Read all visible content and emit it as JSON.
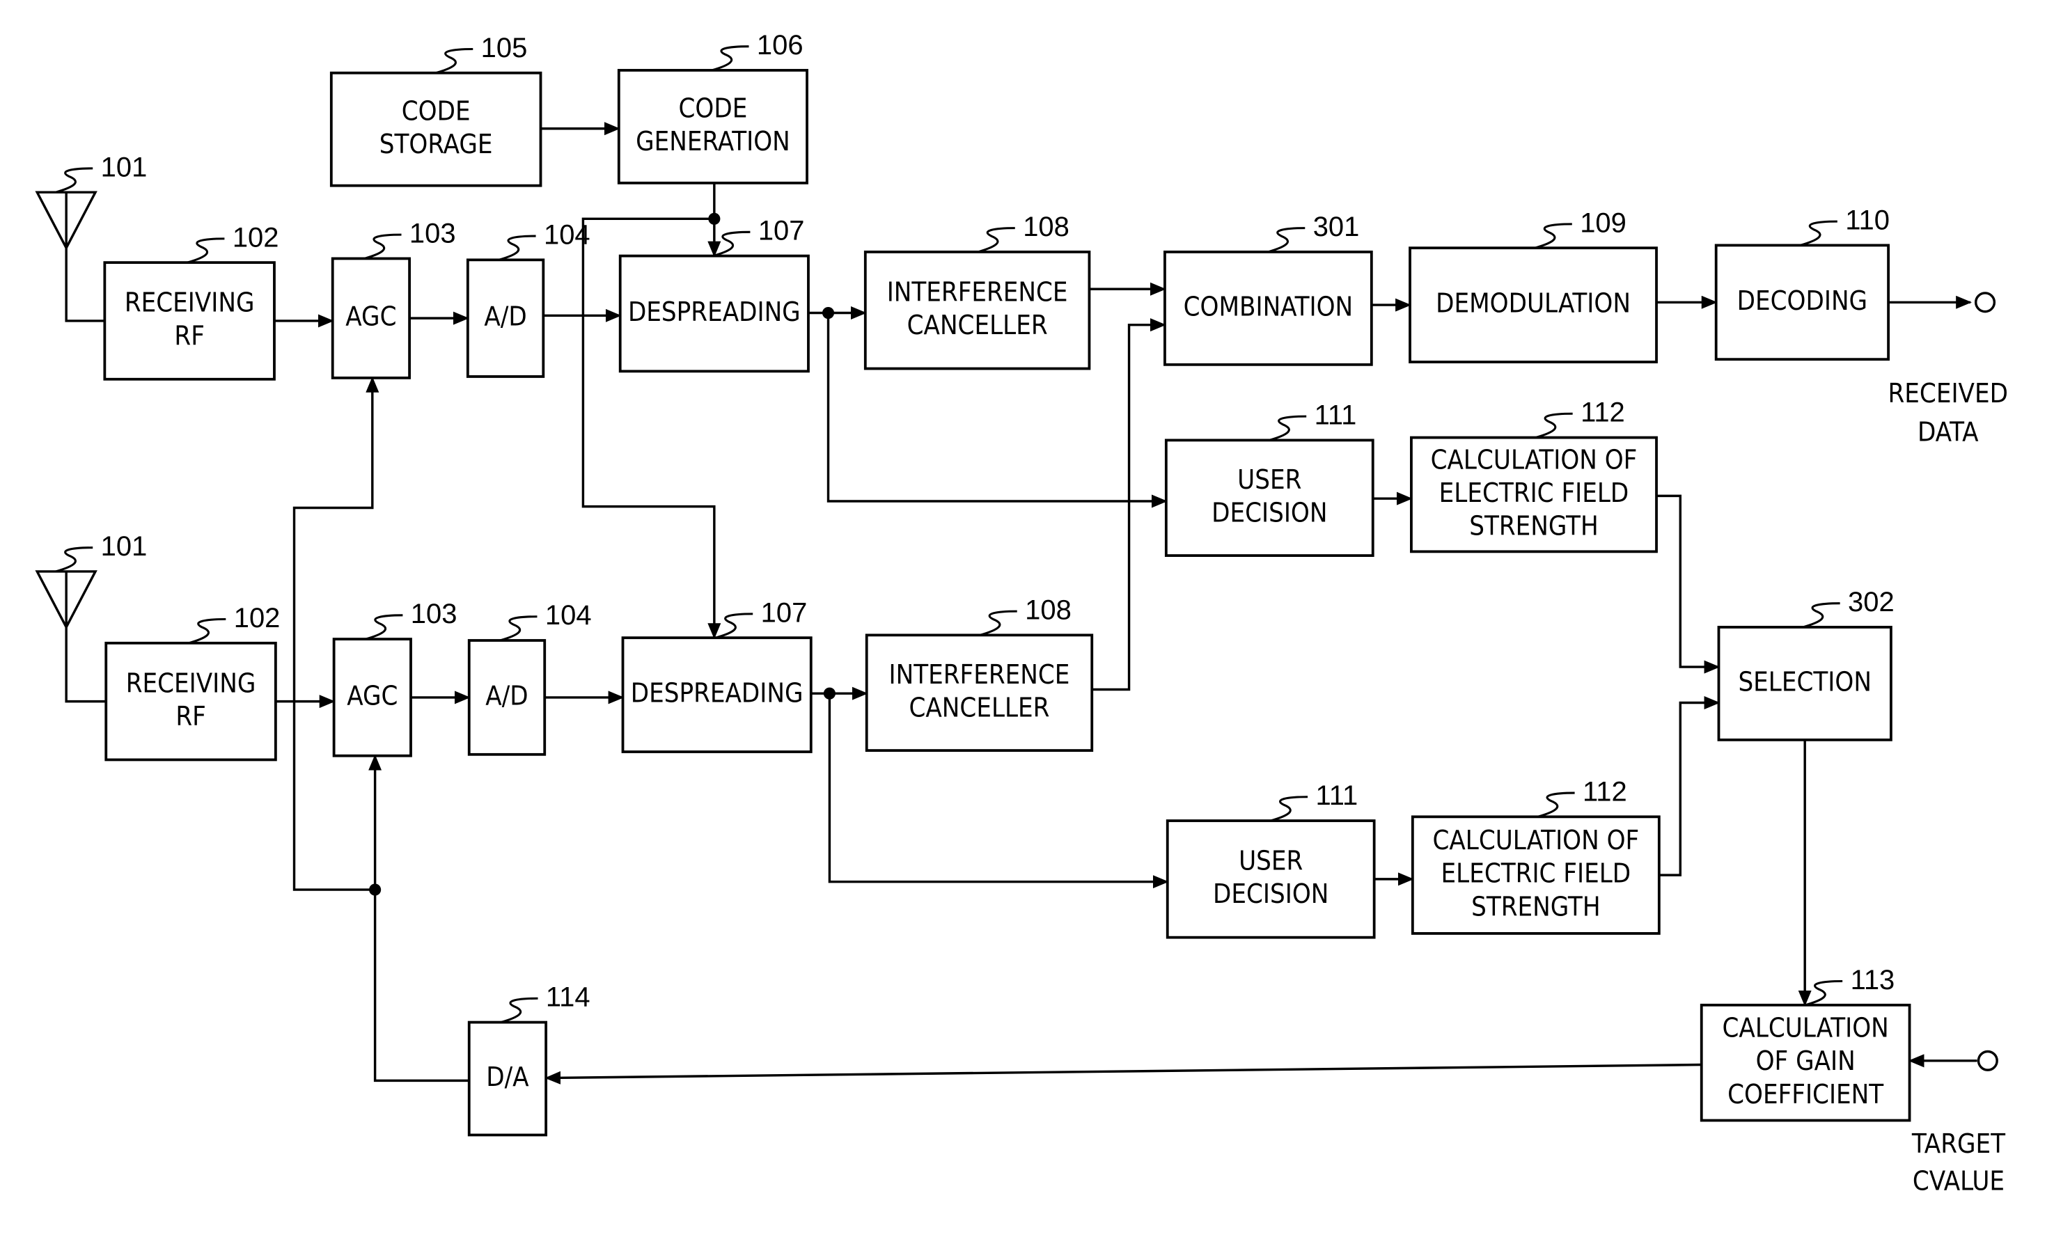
{
  "figure": {
    "blocks": [
      {
        "id": "code_storage",
        "ref": "105",
        "lines": [
          "CODE",
          "STORAGE"
        ]
      },
      {
        "id": "code_generation",
        "ref": "106",
        "lines": [
          "CODE",
          "GENERATION"
        ]
      },
      {
        "id": "antenna_1",
        "ref": "101"
      },
      {
        "id": "receiving_rf_1",
        "ref": "102",
        "lines": [
          "RECEIVING",
          "RF"
        ]
      },
      {
        "id": "agc_1",
        "ref": "103",
        "lines": [
          "AGC"
        ]
      },
      {
        "id": "ad_1",
        "ref": "104",
        "lines": [
          "A/D"
        ]
      },
      {
        "id": "despreading_1",
        "ref": "107",
        "lines": [
          "DESPREADING"
        ]
      },
      {
        "id": "interference_canceller_1",
        "ref": "108",
        "lines": [
          "INTERFERENCE",
          "CANCELLER"
        ]
      },
      {
        "id": "combination",
        "ref": "301",
        "lines": [
          "COMBINATION"
        ]
      },
      {
        "id": "demodulation",
        "ref": "109",
        "lines": [
          "DEMODULATION"
        ]
      },
      {
        "id": "decoding",
        "ref": "110",
        "lines": [
          "DECODING"
        ]
      },
      {
        "id": "user_decision_1",
        "ref": "111",
        "lines": [
          "USER",
          "DECISION"
        ]
      },
      {
        "id": "field_strength_1",
        "ref": "112",
        "lines": [
          "CALCULATION OF",
          "ELECTRIC FIELD",
          "STRENGTH"
        ]
      },
      {
        "id": "antenna_2",
        "ref": "101"
      },
      {
        "id": "receiving_rf_2",
        "ref": "102",
        "lines": [
          "RECEIVING",
          "RF"
        ]
      },
      {
        "id": "agc_2",
        "ref": "103",
        "lines": [
          "AGC"
        ]
      },
      {
        "id": "ad_2",
        "ref": "104",
        "lines": [
          "A/D"
        ]
      },
      {
        "id": "despreading_2",
        "ref": "107",
        "lines": [
          "DESPREADING"
        ]
      },
      {
        "id": "interference_canceller_2",
        "ref": "108",
        "lines": [
          "INTERFERENCE",
          "CANCELLER"
        ]
      },
      {
        "id": "selection",
        "ref": "302",
        "lines": [
          "SELECTION"
        ]
      },
      {
        "id": "user_decision_2",
        "ref": "111",
        "lines": [
          "USER",
          "DECISION"
        ]
      },
      {
        "id": "field_strength_2",
        "ref": "112",
        "lines": [
          "CALCULATION OF",
          "ELECTRIC FIELD",
          "STRENGTH"
        ]
      },
      {
        "id": "gain_coefficient",
        "ref": "113",
        "lines": [
          "CALCULATION",
          "OF GAIN",
          "COEFFICIENT"
        ]
      },
      {
        "id": "da",
        "ref": "114",
        "lines": [
          "D/A"
        ]
      }
    ],
    "terminals": {
      "received_data": [
        "RECEIVED",
        "DATA"
      ],
      "target_value": [
        "TARGET",
        "CVALUE"
      ]
    }
  }
}
